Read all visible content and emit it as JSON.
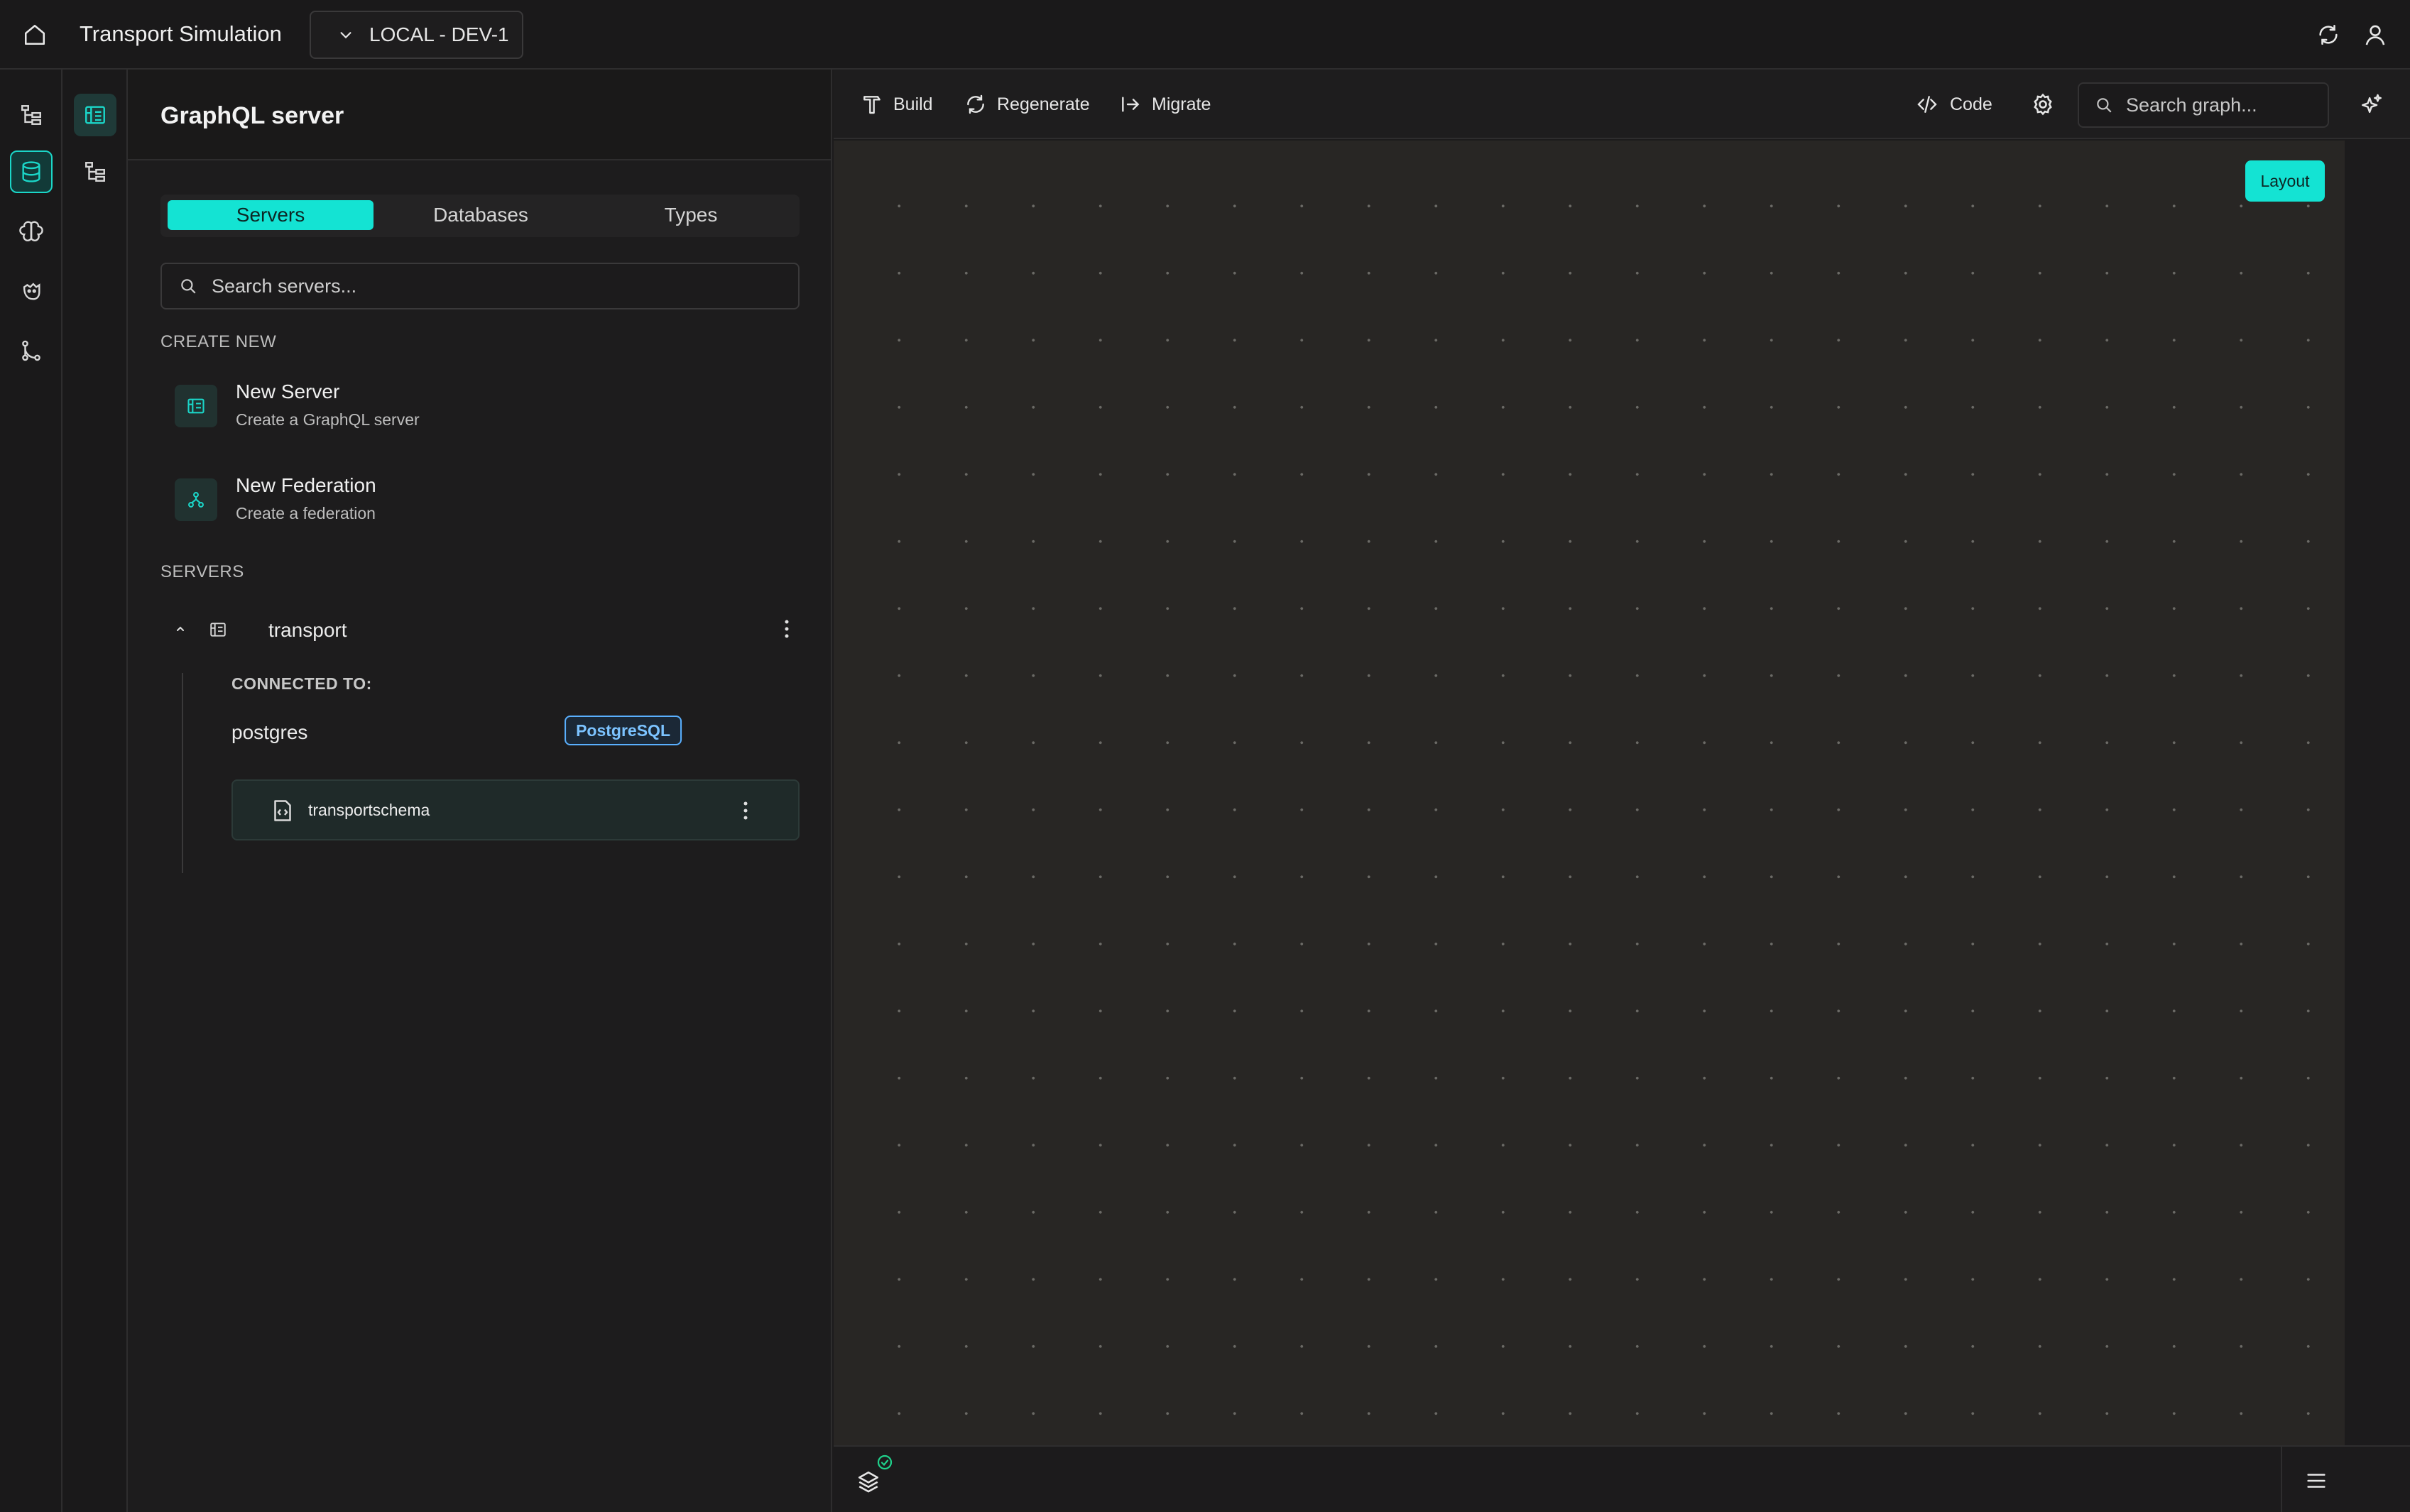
{
  "app": {
    "title": "Transport Simulation",
    "environment": "LOCAL - DEV-1"
  },
  "colors": {
    "accent": "#14e3d3",
    "background": "#1c1b1c",
    "canvas": "#282624",
    "postgres_badge": "#5ab0ff"
  },
  "rail": {
    "items": [
      {
        "icon": "hierarchy-icon"
      },
      {
        "icon": "database-icon",
        "active": true
      },
      {
        "icon": "brain-icon"
      },
      {
        "icon": "bot-icon"
      },
      {
        "icon": "branch-icon"
      }
    ]
  },
  "rail2": {
    "items": [
      {
        "icon": "server-dashboard-icon",
        "active": true
      },
      {
        "icon": "tree-icon"
      }
    ]
  },
  "panel": {
    "title": "GraphQL server",
    "tabs": [
      {
        "label": "Servers",
        "active": true
      },
      {
        "label": "Databases"
      },
      {
        "label": "Types"
      }
    ],
    "search_placeholder": "Search servers...",
    "create_new_label": "CREATE NEW",
    "create_items": [
      {
        "title": "New Server",
        "subtitle": "Create a GraphQL server",
        "icon": "server-icon"
      },
      {
        "title": "New Federation",
        "subtitle": "Create a federation",
        "icon": "federation-icon"
      }
    ],
    "servers_label": "SERVERS",
    "server": {
      "name": "transport",
      "connected_label": "CONNECTED TO:",
      "database": "postgres",
      "database_type": "PostgreSQL",
      "schema": "transportschema"
    }
  },
  "toolbar": {
    "build": "Build",
    "regenerate": "Regenerate",
    "migrate": "Migrate",
    "code": "Code",
    "search_placeholder": "Search graph..."
  },
  "canvas": {
    "layout_button": "Layout"
  }
}
